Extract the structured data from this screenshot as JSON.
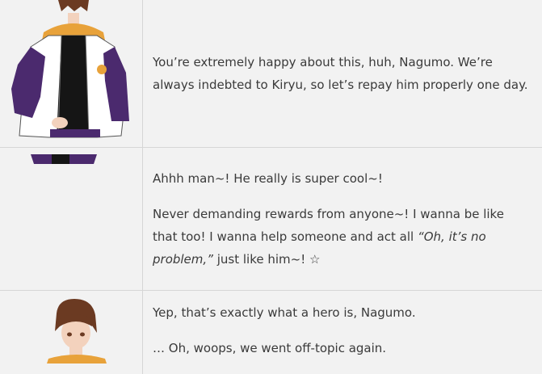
{
  "rows": [
    {
      "speaker_portrait": "nagumo-portrait",
      "lines": [
        "You’re extremely happy about this, huh, Nagumo. We’re always indebted to Kiryu, so let’s repay him properly one day."
      ]
    },
    {
      "speaker_portrait": "tetora-portrait-cropped",
      "lines": [
        "Ahhh man~! He really is super cool~!",
        "Never demanding rewards from anyone~! I wanna be like that too! I wanna help someone and act all",
        "“Oh, it’s no problem,”",
        "just like him~! ☆"
      ]
    },
    {
      "speaker_portrait": "chiaki-portrait",
      "lines": [
        "Yep, that’s exactly what a hero is, Nagumo.",
        "… Oh, woops, we went off-topic again."
      ]
    }
  ],
  "colors": {
    "background": "#f2f2f2",
    "border": "#d6d6d6",
    "text": "#3a3a3a",
    "jacket_purple": "#4b2a6e",
    "hood_orange": "#e8a23a",
    "hair_brown": "#6b3a22"
  }
}
